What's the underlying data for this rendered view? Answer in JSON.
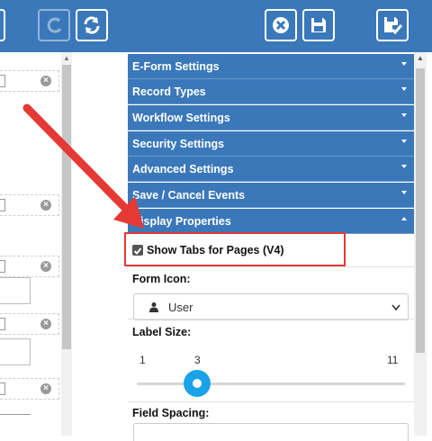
{
  "toolbar": {
    "buttons": [
      {
        "name": "undo-button",
        "icon": "undo-icon"
      },
      {
        "name": "refresh-button",
        "icon": "refresh-icon"
      },
      {
        "name": "close-button",
        "icon": "close-circle-icon"
      },
      {
        "name": "save-button",
        "icon": "save-icon"
      },
      {
        "name": "save-check-button",
        "icon": "save-check-icon"
      }
    ],
    "color": "#3a78ba"
  },
  "panel": {
    "sections": [
      {
        "label": "E-Form Settings",
        "expanded": false
      },
      {
        "label": "Record Types",
        "expanded": false
      },
      {
        "label": "Workflow Settings",
        "expanded": false
      },
      {
        "label": "Security Settings",
        "expanded": false
      },
      {
        "label": "Advanced Settings",
        "expanded": false
      },
      {
        "label": "Save / Cancel Events",
        "expanded": false
      },
      {
        "label": "Display Properties",
        "expanded": true
      }
    ],
    "display": {
      "show_tabs_label": "Show Tabs for Pages (V4)",
      "show_tabs_checked": true,
      "form_icon_label": "Form Icon:",
      "form_icon_value": "User",
      "label_size_label": "Label Size:",
      "label_size_min": "1",
      "label_size_value": "3",
      "label_size_max": "11",
      "field_spacing_label": "Field Spacing:"
    }
  },
  "annotation": {
    "arrow_color": "#e53935",
    "highlight_color": "#e53935"
  }
}
